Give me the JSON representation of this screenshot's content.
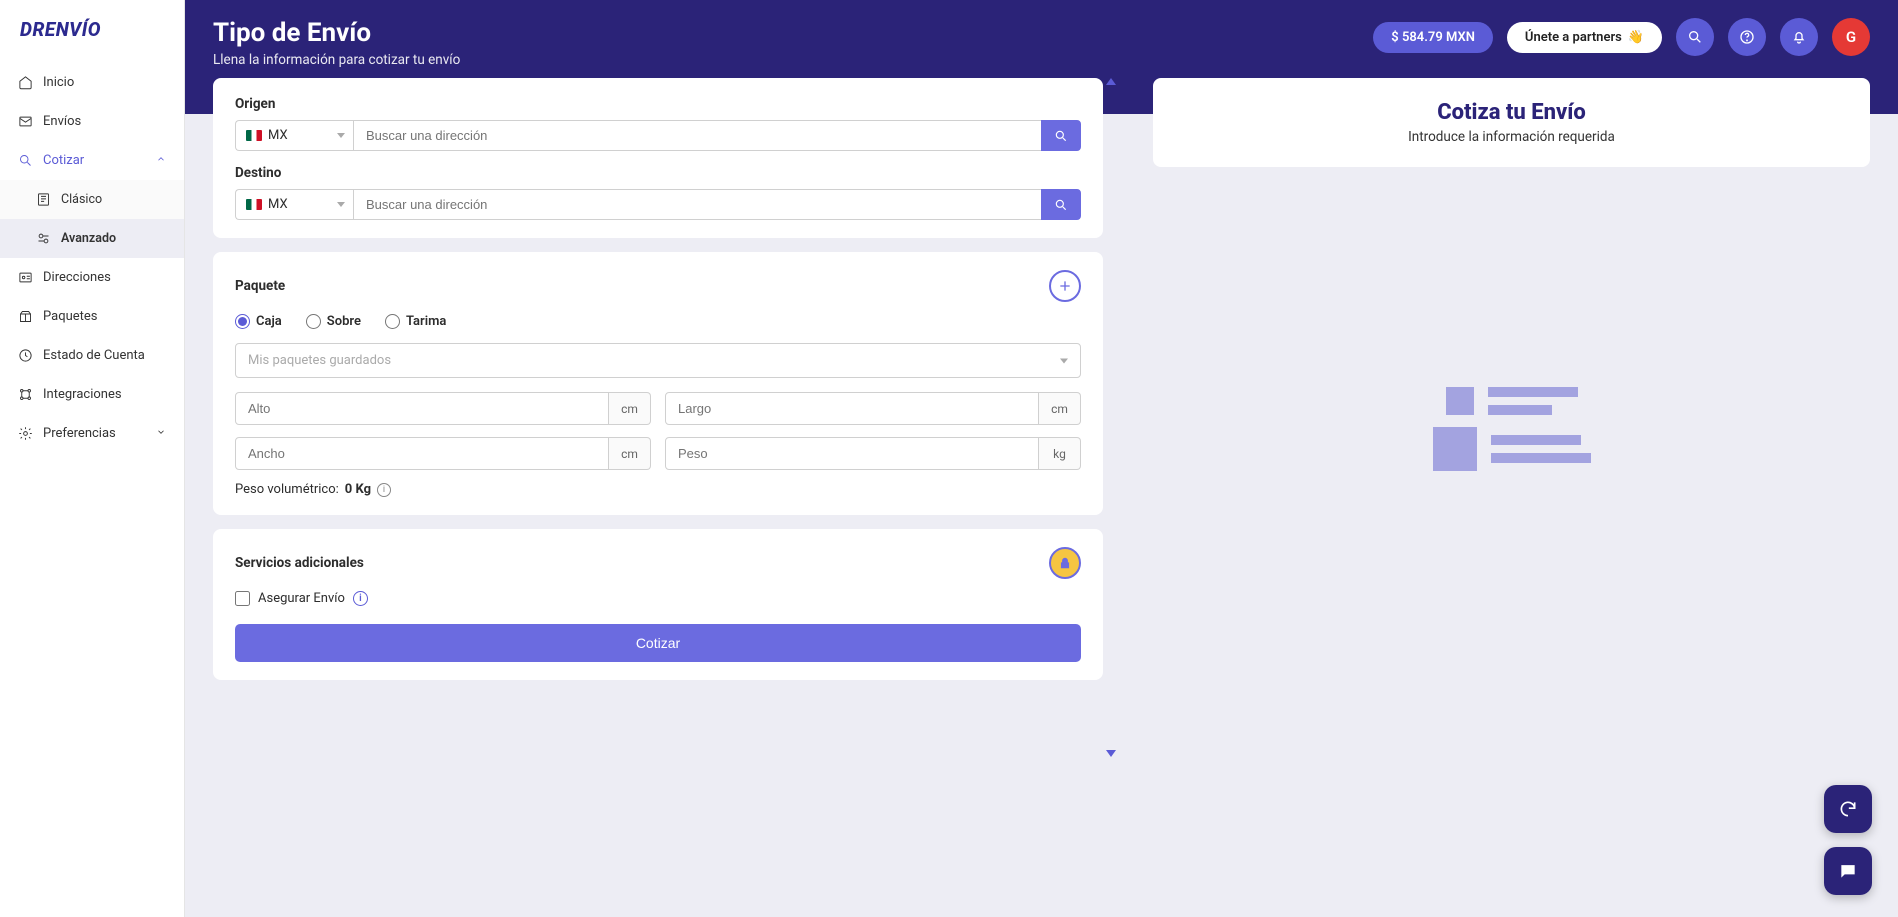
{
  "brand": "DRENVÍO",
  "nav": {
    "home": "Inicio",
    "envios": "Envíos",
    "cotizar": "Cotizar",
    "clasico": "Clásico",
    "avanzado": "Avanzado",
    "direcciones": "Direcciones",
    "paquetes": "Paquetes",
    "cuenta": "Estado de Cuenta",
    "integraciones": "Integraciones",
    "preferencias": "Preferencias"
  },
  "header": {
    "title": "Tipo de Envío",
    "subtitle": "Llena la información para cotizar tu envío",
    "balance": "$ 584.79 MXN",
    "partners": "Únete a partners",
    "partners_emoji": "👋",
    "avatar_letter": "G"
  },
  "origin": {
    "label": "Origen",
    "country": "MX",
    "placeholder": "Buscar una dirección"
  },
  "destination": {
    "label": "Destino",
    "country": "MX",
    "placeholder": "Buscar una dirección"
  },
  "package": {
    "label": "Paquete",
    "types": {
      "caja": "Caja",
      "sobre": "Sobre",
      "tarima": "Tarima"
    },
    "saved_placeholder": "Mis paquetes guardados",
    "dims": {
      "alto": "Alto",
      "largo": "Largo",
      "ancho": "Ancho",
      "peso": "Peso",
      "cm": "cm",
      "kg": "kg"
    },
    "vol_label": "Peso volumétrico:",
    "vol_value": "0 Kg"
  },
  "services": {
    "label": "Servicios adicionales",
    "insure": "Asegurar Envío",
    "quote_btn": "Cotizar"
  },
  "right": {
    "title": "Cotiza tu Envío",
    "subtitle": "Introduce la información requerida"
  }
}
